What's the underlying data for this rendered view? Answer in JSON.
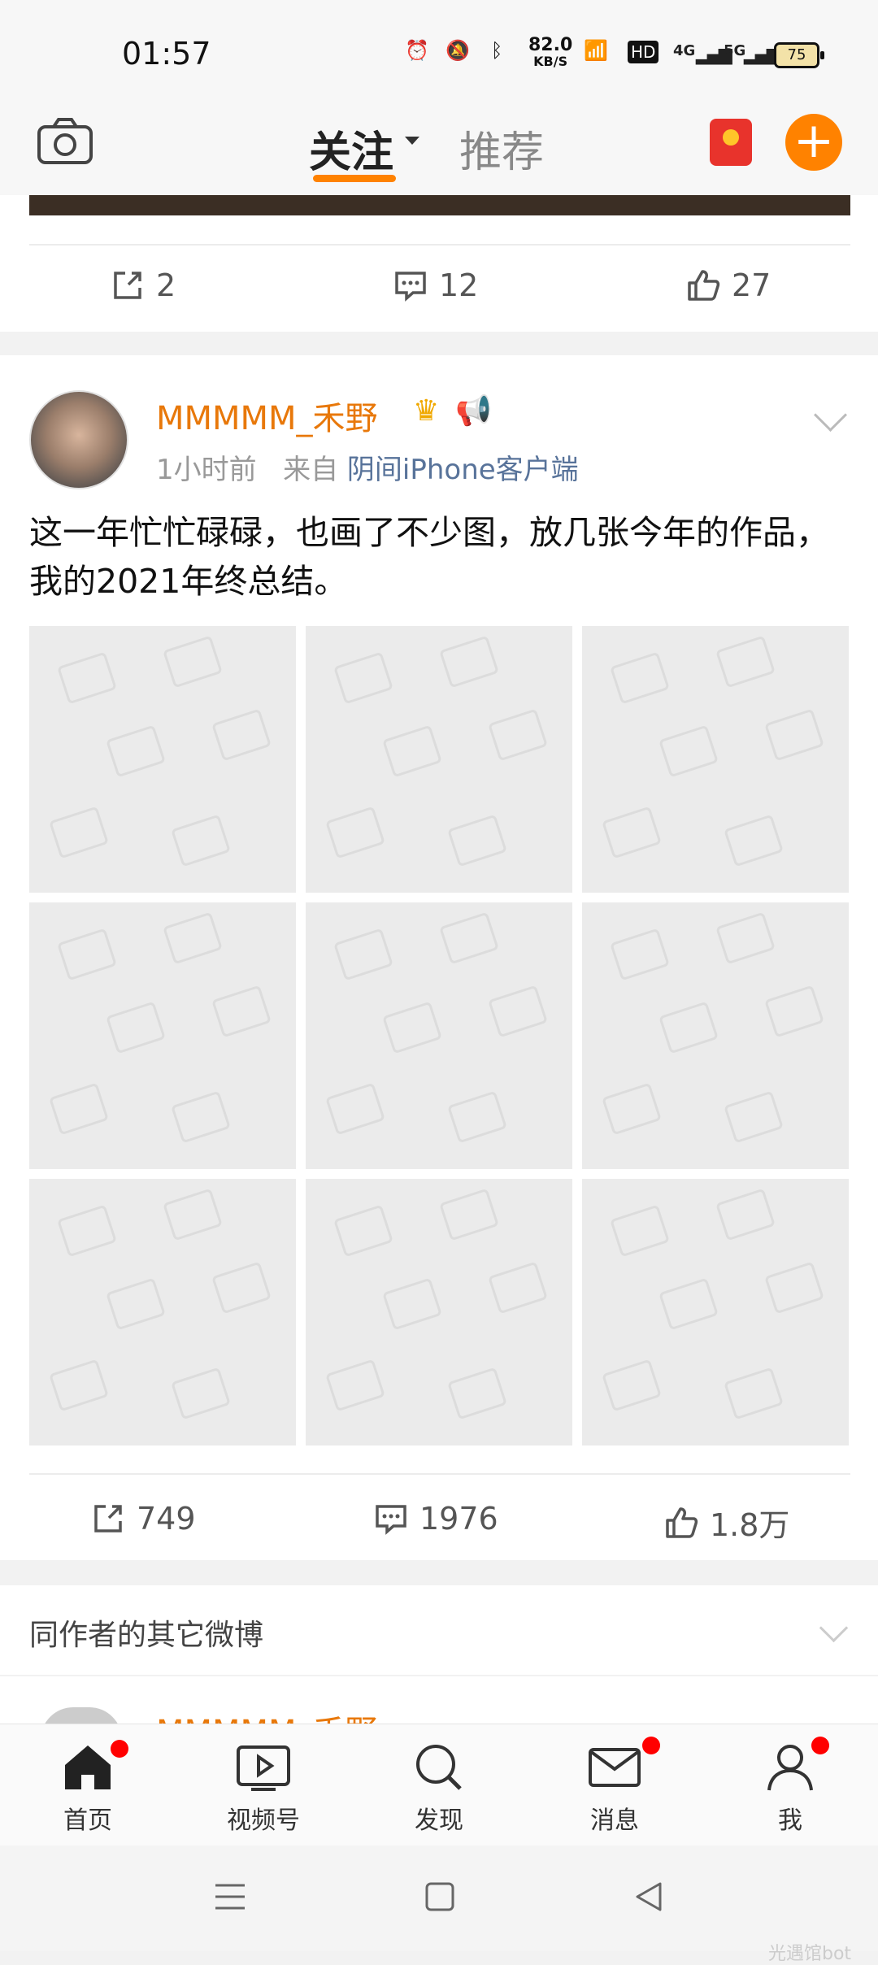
{
  "status": {
    "time": "01:57",
    "net_speed": "82.0",
    "net_unit": "KB/S",
    "hd": "HD",
    "sig1": "4G",
    "sig2": "5G",
    "battery": "75"
  },
  "nav": {
    "follow_tab": "关注",
    "recommend_tab": "推荐"
  },
  "prev_post": {
    "shares": "2",
    "comments": "12",
    "likes": "27"
  },
  "post": {
    "username": "MMMMM_禾野",
    "time": "1小时前",
    "from_label": "来自",
    "source": "阴间iPhone客户端",
    "text": "这一年忙忙碌碌，也画了不少图，放几张今年的作品，我的2021年终总结。",
    "shares": "749",
    "comments": "1976",
    "likes": "1.8万"
  },
  "more": {
    "title": "同作者的其它微博",
    "peek_name": "MMMMM_禾野"
  },
  "tabbar": {
    "home": "首页",
    "video": "视频号",
    "discover": "发现",
    "messages": "消息",
    "me": "我"
  },
  "watermark": "光遇馆bot",
  "colors": {
    "accent": "#ff8200",
    "username": "#e8780a",
    "link": "#58739a",
    "badge": "#ff0000"
  }
}
